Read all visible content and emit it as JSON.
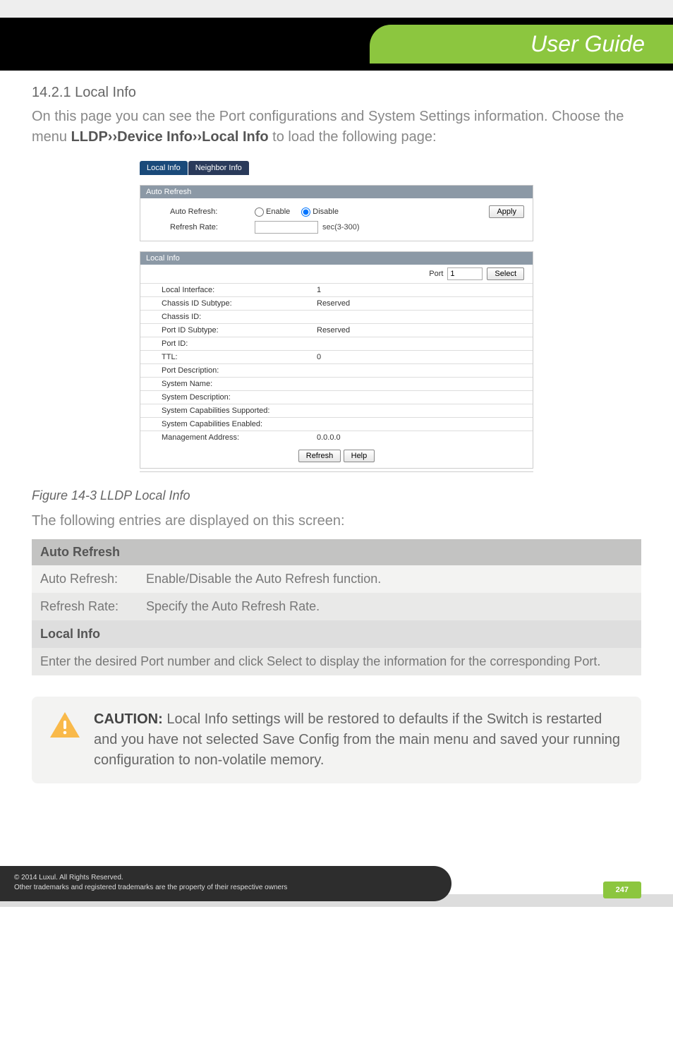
{
  "header": {
    "title": "User Guide"
  },
  "section": {
    "heading": "14.2.1 Local Info",
    "intro_pre": "On this page you can see the Port configurations and System Settings information. Choose the menu ",
    "intro_bold": "LLDP››Device Info››Local Info",
    "intro_post": " to load the following page:"
  },
  "screenshot": {
    "tabs": {
      "active": "Local Info",
      "inactive": "Neighbor Info"
    },
    "autorefresh": {
      "title": "Auto Refresh",
      "row1_label": "Auto Refresh:",
      "enable": "Enable",
      "disable": "Disable",
      "row2_label": "Refresh Rate:",
      "rate_value": "",
      "rate_suffix": "sec(3-300)",
      "apply": "Apply"
    },
    "localinfo": {
      "title": "Local Info",
      "port_label": "Port",
      "port_value": "1",
      "select": "Select",
      "rows": [
        {
          "label": "Local Interface:",
          "value": "1"
        },
        {
          "label": "Chassis ID Subtype:",
          "value": "Reserved"
        },
        {
          "label": "Chassis ID:",
          "value": ""
        },
        {
          "label": "Port ID Subtype:",
          "value": "Reserved"
        },
        {
          "label": "Port ID:",
          "value": ""
        },
        {
          "label": "TTL:",
          "value": "0"
        },
        {
          "label": "Port Description:",
          "value": ""
        },
        {
          "label": "System Name:",
          "value": ""
        },
        {
          "label": "System Description:",
          "value": ""
        },
        {
          "label": "System Capabilities Supported:",
          "value": ""
        },
        {
          "label": "System Capabilities Enabled:",
          "value": ""
        },
        {
          "label": "Management Address:",
          "value": "0.0.0.0"
        }
      ],
      "refresh": "Refresh",
      "help": "Help"
    }
  },
  "figure_caption": "Figure 14-3 LLDP Local Info",
  "lead": "The following entries are displayed on this screen:",
  "entries": {
    "sec1_title": "Auto Refresh",
    "r1_label": "Auto Refresh:",
    "r1_desc": "Enable/Disable the Auto Refresh function.",
    "r2_label": "Refresh Rate:",
    "r2_desc": "Specify the Auto Refresh Rate.",
    "sec2_title": "Local Info",
    "sec2_desc": "Enter the desired Port number and click Select to display the information for the corresponding Port."
  },
  "caution": {
    "label": "CAUTION:",
    "text": " Local Info settings will be restored to defaults if the Switch is restarted and you have not selected Save Config from the main menu and saved your running configuration to non-volatile memory."
  },
  "footer": {
    "line1": "© 2014  Luxul. All Rights Reserved.",
    "line2": "Other trademarks and registered trademarks are the property of their respective owners",
    "page": "247"
  }
}
